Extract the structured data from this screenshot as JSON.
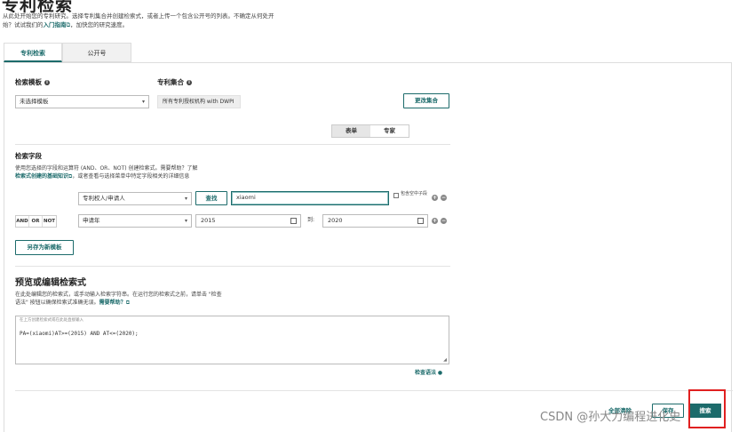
{
  "page": {
    "title": "专利检索"
  },
  "intro": {
    "line1": "从此处开始您的专利研究。选择专利集合并创建检索式，或者上传一个包含公开号的列表。不确定从何处开",
    "line2_prefix": "始？试试我们的",
    "guide_link": "入门指南",
    "line2_suffix": "，加快您的研究速度。"
  },
  "tabs": [
    {
      "label": "专利检索"
    },
    {
      "label": "公开号"
    }
  ],
  "template": {
    "label": "检索模板",
    "value": "未选择模板"
  },
  "collection": {
    "label": "专利集合",
    "value": "所有专利授权机构 with DWPI",
    "change_button": "更改集合"
  },
  "mode_toggle": [
    {
      "label": "表单",
      "selected": true
    },
    {
      "label": "专家",
      "selected": false
    }
  ],
  "fields": {
    "label": "检索字段",
    "help_line1": "使用您选择的字段和运算符 (AND、OR、NOT) 创建检索式。需要帮助？了解",
    "help_link": "检索式创建的基础知识",
    "help_line2": "，或者查看与选择菜单中特定字段相关的详细信息",
    "row1": {
      "field": "专利权人/申请人",
      "lookup_button": "查找",
      "value": "xiaomi",
      "checkbox_label": "包含空中子段"
    },
    "row2": {
      "operators": [
        "AND",
        "OR",
        "NOT"
      ],
      "field": "申请年",
      "from_value": "2015",
      "to_label": "到:",
      "to_value": "2020"
    },
    "save_template_button": "另存为新模板"
  },
  "preview": {
    "heading": "预览或编辑检索式",
    "desc_line1": "在此处编辑您的检索式，或手动输入检索字符串。在运行您的检索式之前，请单击 \"检查",
    "desc_line2_prefix": "语法\" 按钮以确保检索式准确无误。",
    "help_link": "需要帮助？",
    "field_hint": "在上方创建检索式或在此处直接输入",
    "query": "PA=(xiaomi)AT>=(2015) AND AT<=(2020);",
    "check_syntax": "检查语法"
  },
  "footer": {
    "clear_all": "全部清除",
    "save_button": "保存",
    "search_button": "搜索"
  },
  "watermark": "CSDN @孙大力编程进化史"
}
